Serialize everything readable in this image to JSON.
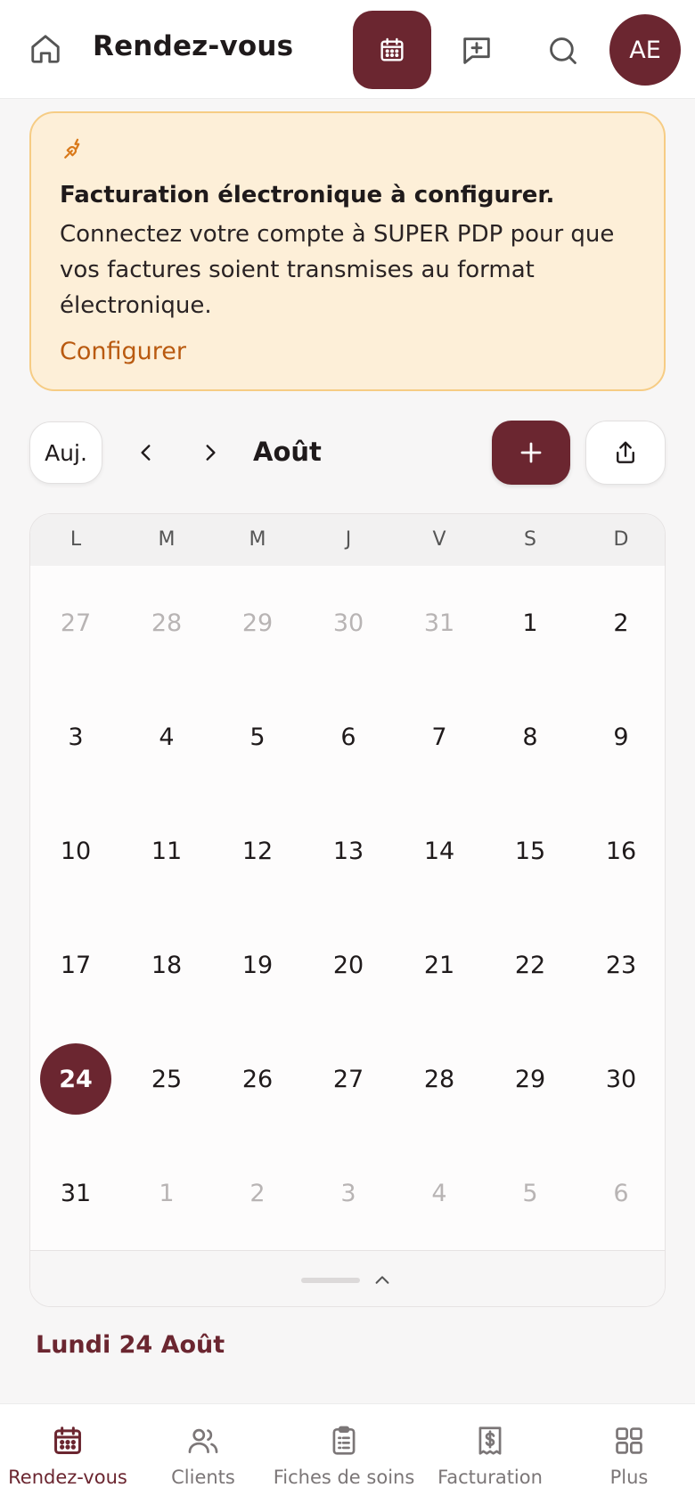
{
  "colors": {
    "accent": "#6b2630",
    "banner_bg": "#fdefd8",
    "banner_border": "#f6cc84",
    "link": "#b95a10",
    "muted_day": "#b8b4b4"
  },
  "header": {
    "title": "Rendez-vous",
    "home_icon": "home-icon",
    "calendar_icon": "calendar-icon",
    "chat_icon": "message-plus-icon",
    "search_icon": "search-icon",
    "avatar_initials": "AE"
  },
  "banner": {
    "icon": "plug-icon",
    "title": "Facturation électronique à configurer.",
    "body": "Connectez votre compte à SUPER PDP pour que vos factures soient transmises au format électronique.",
    "link": "Configurer"
  },
  "toolbar": {
    "today_label": "Auj.",
    "month": "Août",
    "prev_icon": "chevron-left-icon",
    "next_icon": "chevron-right-icon",
    "add_icon": "plus-icon",
    "share_icon": "share-icon"
  },
  "calendar": {
    "weekdays": [
      "L",
      "M",
      "M",
      "J",
      "V",
      "S",
      "D"
    ],
    "weeks": [
      [
        {
          "d": "27",
          "m": true
        },
        {
          "d": "28",
          "m": true
        },
        {
          "d": "29",
          "m": true
        },
        {
          "d": "30",
          "m": true
        },
        {
          "d": "31",
          "m": true
        },
        {
          "d": "1"
        },
        {
          "d": "2"
        }
      ],
      [
        {
          "d": "3"
        },
        {
          "d": "4"
        },
        {
          "d": "5"
        },
        {
          "d": "6"
        },
        {
          "d": "7"
        },
        {
          "d": "8"
        },
        {
          "d": "9"
        }
      ],
      [
        {
          "d": "10"
        },
        {
          "d": "11"
        },
        {
          "d": "12"
        },
        {
          "d": "13"
        },
        {
          "d": "14"
        },
        {
          "d": "15"
        },
        {
          "d": "16"
        }
      ],
      [
        {
          "d": "17"
        },
        {
          "d": "18"
        },
        {
          "d": "19"
        },
        {
          "d": "20"
        },
        {
          "d": "21"
        },
        {
          "d": "22"
        },
        {
          "d": "23"
        }
      ],
      [
        {
          "d": "24",
          "s": true
        },
        {
          "d": "25"
        },
        {
          "d": "26"
        },
        {
          "d": "27"
        },
        {
          "d": "28"
        },
        {
          "d": "29"
        },
        {
          "d": "30"
        }
      ],
      [
        {
          "d": "31"
        },
        {
          "d": "1",
          "m": true
        },
        {
          "d": "2",
          "m": true
        },
        {
          "d": "3",
          "m": true
        },
        {
          "d": "4",
          "m": true
        },
        {
          "d": "5",
          "m": true
        },
        {
          "d": "6",
          "m": true
        }
      ]
    ],
    "collapse_icon": "chevron-up-icon"
  },
  "selected_date": "Lundi 24 Août",
  "bottom_nav": [
    {
      "label": "Rendez-vous",
      "icon": "calendar-icon",
      "active": true
    },
    {
      "label": "Clients",
      "icon": "users-icon"
    },
    {
      "label": "Fiches de soins",
      "icon": "clipboard-icon"
    },
    {
      "label": "Facturation",
      "icon": "receipt-dollar-icon"
    },
    {
      "label": "Plus",
      "icon": "grid-icon"
    }
  ]
}
